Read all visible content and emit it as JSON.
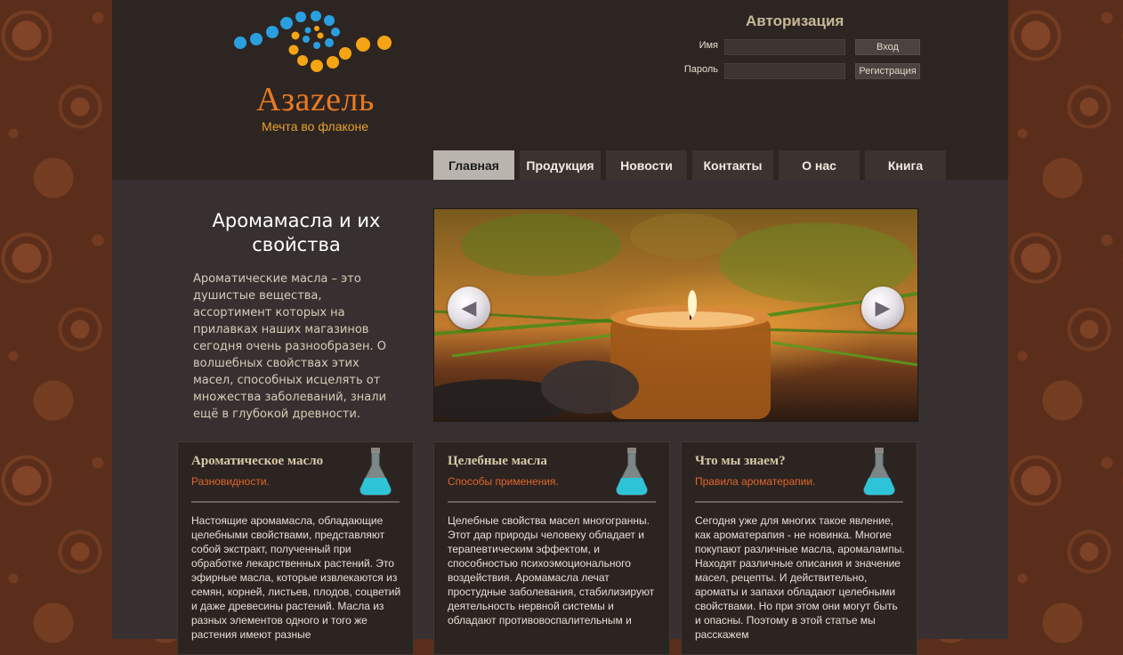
{
  "brand": {
    "name": "Азаzель",
    "tagline": "Мечта во флаконе"
  },
  "auth": {
    "title": "Авторизация",
    "name_label": "Имя",
    "password_label": "Пароль",
    "name_value": "",
    "password_value": "",
    "login_button": "Вход",
    "register_button": "Регистрация"
  },
  "nav": {
    "items": [
      "Главная",
      "Продукция",
      "Новости",
      "Контакты",
      "О нас",
      "Книга"
    ],
    "active": "Главная"
  },
  "intro": {
    "title": "Аромамасла и их свойства",
    "text": "Ароматические масла – это душистые вещества, ассортимент которых на прилавках наших магазинов сегодня очень разнообразен. О волшебных свойствах этих масел, способных исцелять от множества заболеваний, знали ещё в глубокой древности."
  },
  "slider": {
    "image_icon": "candle-photo",
    "prev_icon": "arrow-left-icon",
    "next_icon": "arrow-right-icon"
  },
  "boxes": [
    {
      "title": "Ароматическое масло",
      "subtitle": "Разновидности.",
      "text": "Настоящие аромамасла, обладающие целебными свойствами, представляют собой экстракт, полученный при обработке лекарственных растений. Это эфирные масла, которые извлекаются из семян, корней, листьев, плодов, соцветий и даже древесины растений. Масла из разных элементов одного и того же растения имеют разные"
    },
    {
      "title": "Целебные масла",
      "subtitle": "Способы применения.",
      "text": "Целебные свойства масел многогранны. Этот дар природы человеку обладает и терапевтическим эффектом, и способностью психоэмоционального воздействия. Аромамасла лечат простудные заболевания, стабилизируют деятельность нервной системы и обладают противовоспалительным и"
    },
    {
      "title": "Что мы знаем?",
      "subtitle": "Правила ароматерапии.",
      "text": "Сегодня уже для многих такое явление, как ароматерапия - не новинка. Многие покупают различные масла, аромалампы. Находят различные описания и значение масел, рецепты. И действительно, ароматы и запахи обладают целебными свойствами. Но при этом они могут быть и опасны. Поэтому в этой статье мы расскажем"
    }
  ],
  "colors": {
    "accent_orange": "#e87a22",
    "subtitle_orange": "#e2662a",
    "header_bg": "#2d2522",
    "content_bg": "#383030",
    "nav_active_bg": "#b9b5ae",
    "dot_blue": "#2a9fe0",
    "dot_orange": "#f5a414"
  }
}
